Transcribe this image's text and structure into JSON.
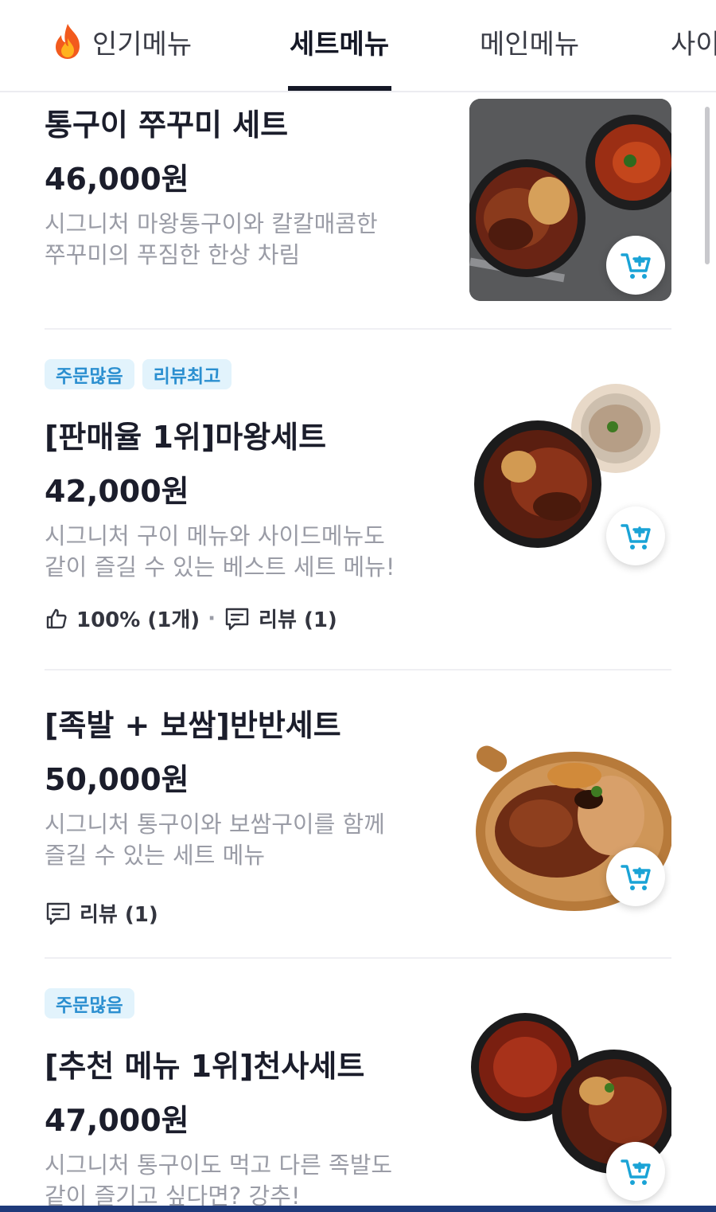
{
  "tabs": [
    {
      "label": "인기메뉴",
      "icon": "fire-icon"
    },
    {
      "label": "세트메뉴",
      "active": true
    },
    {
      "label": "메인메뉴"
    },
    {
      "label": "사이"
    }
  ],
  "items": [
    {
      "name": "통구이 쭈꾸미 세트",
      "price": "46,000원",
      "desc_lines": [
        "시그니처 마왕통구이와 칼칼매콤한",
        "쭈꾸미의 푸짐한 한상 차림"
      ],
      "badges": []
    },
    {
      "name": "[판매율 1위]마왕세트",
      "price": "42,000원",
      "desc_lines": [
        "시그니처 구이 메뉴와 사이드메뉴도",
        "같이 즐길 수 있는 베스트 세트 메뉴!"
      ],
      "badges": [
        "주문많음",
        "리뷰최고"
      ],
      "like": "100% (1개)",
      "separator": "·",
      "review": "리뷰 (1)"
    },
    {
      "name": "[족발 + 보쌈]반반세트",
      "price": "50,000원",
      "desc_lines": [
        "시그니처 통구이와 보쌈구이를 함께",
        "즐길 수 있는 세트 메뉴"
      ],
      "badges": [],
      "review": "리뷰 (1)"
    },
    {
      "name": "[추천 메뉴 1위]천사세트",
      "price": "47,000원",
      "desc_lines": [
        "시그니처 통구이도 먹고 다른 족발도",
        "같이 즐기고 싶다면? 강추!"
      ],
      "badges": [
        "주문많음"
      ]
    }
  ],
  "colors": {
    "accent_cart": "#1aa3d6",
    "badge_bg": "#e2f3fc",
    "badge_text": "#2b8fd0",
    "tab_underline": "#151826"
  }
}
